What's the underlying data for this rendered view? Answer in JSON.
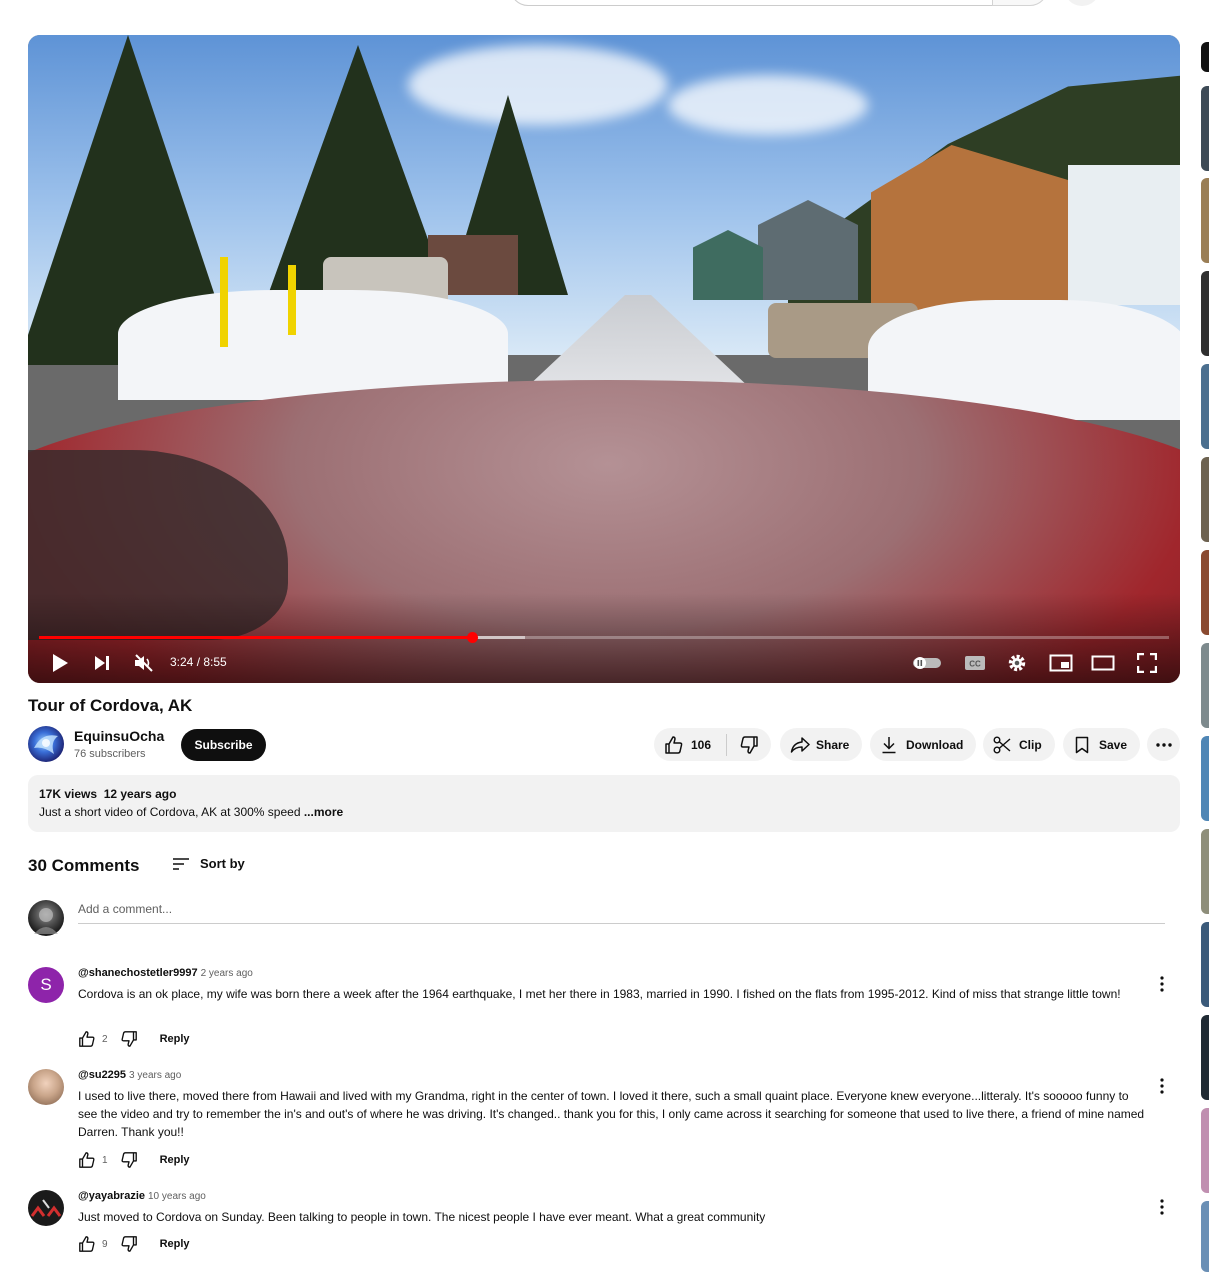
{
  "video": {
    "title": "Tour of Cordova, AK",
    "time_display": "3:24 / 8:55",
    "progress_fraction": 0.383,
    "buffer_fraction": 0.43
  },
  "channel": {
    "name": "EquinsuOcha",
    "subscribers": "76 subscribers",
    "subscribe_label": "Subscribe"
  },
  "actions": {
    "likes": "106",
    "share": "Share",
    "download": "Download",
    "clip": "Clip",
    "save": "Save"
  },
  "description": {
    "meta": "17K views  12 years ago",
    "text": "Just a short video of Cordova, AK at 300% speed ",
    "more": "...more"
  },
  "comments_section": {
    "count_label": "30 Comments",
    "sort_label": "Sort by",
    "add_placeholder": "Add a comment..."
  },
  "comments": [
    {
      "author": "@shanechostetler9997",
      "time": "2 years ago",
      "avatar_letter": "S",
      "avatar_color": "#8e24aa",
      "text": "Cordova is an ok place, my wife was born there a week after the 1964 earthquake, I met her there in 1983, married in 1990. I fished on the flats from 1995-2012. Kind of miss that strange little town!",
      "likes": "2",
      "reply": "Reply"
    },
    {
      "author": "@su2295",
      "time": "3 years ago",
      "avatar_letter": "",
      "avatar_color": "#c9a58a",
      "text": "I used to live there, moved there from Hawaii and lived with my Grandma, right in the center of town.  I loved it there, such a small quaint place. Everyone knew everyone...litteraly. It's sooooo funny to see the video and try to remember the in's and out's of where he was driving. It's changed.. thank you for this, I only came across it searching for someone that used to live there, a friend of mine named Darren. Thank you!!",
      "likes": "1",
      "reply": "Reply"
    },
    {
      "author": "@yayabrazie",
      "time": "10 years ago",
      "avatar_letter": "",
      "avatar_color": "#1a1a1a",
      "text": "Just moved to Cordova on Sunday. Been talking to people in town. The nicest people I have ever meant. What a great community",
      "likes": "9",
      "reply": "Reply"
    }
  ],
  "colors": {
    "accent_red": "#ff0000",
    "chip_bg": "#f2f2f2",
    "text_secondary": "#606060"
  }
}
